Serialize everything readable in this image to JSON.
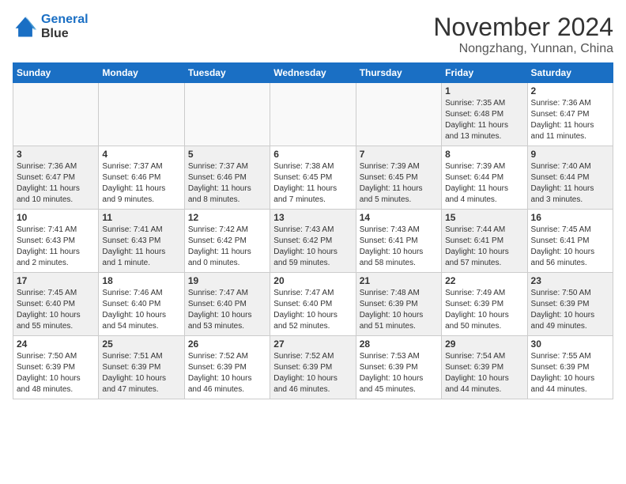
{
  "logo": {
    "line1": "General",
    "line2": "Blue"
  },
  "title": "November 2024",
  "location": "Nongzhang, Yunnan, China",
  "days_of_week": [
    "Sunday",
    "Monday",
    "Tuesday",
    "Wednesday",
    "Thursday",
    "Friday",
    "Saturday"
  ],
  "weeks": [
    [
      {
        "day": "",
        "info": "",
        "shaded": false,
        "empty": true
      },
      {
        "day": "",
        "info": "",
        "shaded": false,
        "empty": true
      },
      {
        "day": "",
        "info": "",
        "shaded": false,
        "empty": true
      },
      {
        "day": "",
        "info": "",
        "shaded": false,
        "empty": true
      },
      {
        "day": "",
        "info": "",
        "shaded": false,
        "empty": true
      },
      {
        "day": "1",
        "info": "Sunrise: 7:35 AM\nSunset: 6:48 PM\nDaylight: 11 hours\nand 13 minutes.",
        "shaded": true,
        "empty": false
      },
      {
        "day": "2",
        "info": "Sunrise: 7:36 AM\nSunset: 6:47 PM\nDaylight: 11 hours\nand 11 minutes.",
        "shaded": false,
        "empty": false
      }
    ],
    [
      {
        "day": "3",
        "info": "Sunrise: 7:36 AM\nSunset: 6:47 PM\nDaylight: 11 hours\nand 10 minutes.",
        "shaded": true,
        "empty": false
      },
      {
        "day": "4",
        "info": "Sunrise: 7:37 AM\nSunset: 6:46 PM\nDaylight: 11 hours\nand 9 minutes.",
        "shaded": false,
        "empty": false
      },
      {
        "day": "5",
        "info": "Sunrise: 7:37 AM\nSunset: 6:46 PM\nDaylight: 11 hours\nand 8 minutes.",
        "shaded": true,
        "empty": false
      },
      {
        "day": "6",
        "info": "Sunrise: 7:38 AM\nSunset: 6:45 PM\nDaylight: 11 hours\nand 7 minutes.",
        "shaded": false,
        "empty": false
      },
      {
        "day": "7",
        "info": "Sunrise: 7:39 AM\nSunset: 6:45 PM\nDaylight: 11 hours\nand 5 minutes.",
        "shaded": true,
        "empty": false
      },
      {
        "day": "8",
        "info": "Sunrise: 7:39 AM\nSunset: 6:44 PM\nDaylight: 11 hours\nand 4 minutes.",
        "shaded": false,
        "empty": false
      },
      {
        "day": "9",
        "info": "Sunrise: 7:40 AM\nSunset: 6:44 PM\nDaylight: 11 hours\nand 3 minutes.",
        "shaded": true,
        "empty": false
      }
    ],
    [
      {
        "day": "10",
        "info": "Sunrise: 7:41 AM\nSunset: 6:43 PM\nDaylight: 11 hours\nand 2 minutes.",
        "shaded": false,
        "empty": false
      },
      {
        "day": "11",
        "info": "Sunrise: 7:41 AM\nSunset: 6:43 PM\nDaylight: 11 hours\nand 1 minute.",
        "shaded": true,
        "empty": false
      },
      {
        "day": "12",
        "info": "Sunrise: 7:42 AM\nSunset: 6:42 PM\nDaylight: 11 hours\nand 0 minutes.",
        "shaded": false,
        "empty": false
      },
      {
        "day": "13",
        "info": "Sunrise: 7:43 AM\nSunset: 6:42 PM\nDaylight: 10 hours\nand 59 minutes.",
        "shaded": true,
        "empty": false
      },
      {
        "day": "14",
        "info": "Sunrise: 7:43 AM\nSunset: 6:41 PM\nDaylight: 10 hours\nand 58 minutes.",
        "shaded": false,
        "empty": false
      },
      {
        "day": "15",
        "info": "Sunrise: 7:44 AM\nSunset: 6:41 PM\nDaylight: 10 hours\nand 57 minutes.",
        "shaded": true,
        "empty": false
      },
      {
        "day": "16",
        "info": "Sunrise: 7:45 AM\nSunset: 6:41 PM\nDaylight: 10 hours\nand 56 minutes.",
        "shaded": false,
        "empty": false
      }
    ],
    [
      {
        "day": "17",
        "info": "Sunrise: 7:45 AM\nSunset: 6:40 PM\nDaylight: 10 hours\nand 55 minutes.",
        "shaded": true,
        "empty": false
      },
      {
        "day": "18",
        "info": "Sunrise: 7:46 AM\nSunset: 6:40 PM\nDaylight: 10 hours\nand 54 minutes.",
        "shaded": false,
        "empty": false
      },
      {
        "day": "19",
        "info": "Sunrise: 7:47 AM\nSunset: 6:40 PM\nDaylight: 10 hours\nand 53 minutes.",
        "shaded": true,
        "empty": false
      },
      {
        "day": "20",
        "info": "Sunrise: 7:47 AM\nSunset: 6:40 PM\nDaylight: 10 hours\nand 52 minutes.",
        "shaded": false,
        "empty": false
      },
      {
        "day": "21",
        "info": "Sunrise: 7:48 AM\nSunset: 6:39 PM\nDaylight: 10 hours\nand 51 minutes.",
        "shaded": true,
        "empty": false
      },
      {
        "day": "22",
        "info": "Sunrise: 7:49 AM\nSunset: 6:39 PM\nDaylight: 10 hours\nand 50 minutes.",
        "shaded": false,
        "empty": false
      },
      {
        "day": "23",
        "info": "Sunrise: 7:50 AM\nSunset: 6:39 PM\nDaylight: 10 hours\nand 49 minutes.",
        "shaded": true,
        "empty": false
      }
    ],
    [
      {
        "day": "24",
        "info": "Sunrise: 7:50 AM\nSunset: 6:39 PM\nDaylight: 10 hours\nand 48 minutes.",
        "shaded": false,
        "empty": false
      },
      {
        "day": "25",
        "info": "Sunrise: 7:51 AM\nSunset: 6:39 PM\nDaylight: 10 hours\nand 47 minutes.",
        "shaded": true,
        "empty": false
      },
      {
        "day": "26",
        "info": "Sunrise: 7:52 AM\nSunset: 6:39 PM\nDaylight: 10 hours\nand 46 minutes.",
        "shaded": false,
        "empty": false
      },
      {
        "day": "27",
        "info": "Sunrise: 7:52 AM\nSunset: 6:39 PM\nDaylight: 10 hours\nand 46 minutes.",
        "shaded": true,
        "empty": false
      },
      {
        "day": "28",
        "info": "Sunrise: 7:53 AM\nSunset: 6:39 PM\nDaylight: 10 hours\nand 45 minutes.",
        "shaded": false,
        "empty": false
      },
      {
        "day": "29",
        "info": "Sunrise: 7:54 AM\nSunset: 6:39 PM\nDaylight: 10 hours\nand 44 minutes.",
        "shaded": true,
        "empty": false
      },
      {
        "day": "30",
        "info": "Sunrise: 7:55 AM\nSunset: 6:39 PM\nDaylight: 10 hours\nand 44 minutes.",
        "shaded": false,
        "empty": false
      }
    ]
  ]
}
